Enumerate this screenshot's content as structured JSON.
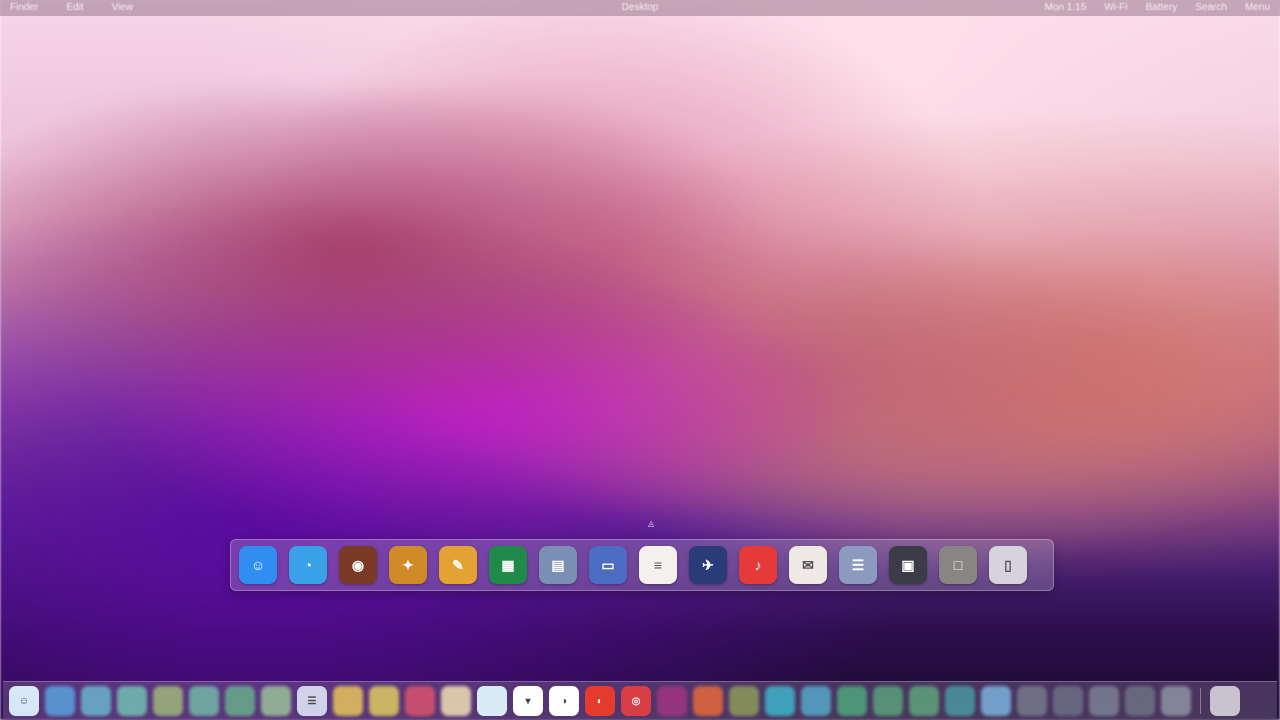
{
  "menubar": {
    "left_items": [
      "Finder",
      "Edit",
      "View"
    ],
    "center_text": "Desktop",
    "right_items": [
      "Mon 1:15",
      "Wi-Fi",
      "Battery",
      "Search",
      "Menu"
    ]
  },
  "switcher": {
    "apps": [
      {
        "name": "finder-icon",
        "glyph": "☺",
        "color": "#2f8ef0"
      },
      {
        "name": "browser-icon",
        "glyph": "◔",
        "color": "#3aa0e8"
      },
      {
        "name": "photo-app-icon",
        "glyph": "◉",
        "color": "#7a3a25"
      },
      {
        "name": "game-icon",
        "glyph": "✦",
        "color": "#d08a28"
      },
      {
        "name": "editor-icon",
        "glyph": "✎",
        "color": "#e4a235"
      },
      {
        "name": "spreadsheet-icon",
        "glyph": "▦",
        "color": "#1f8a4a"
      },
      {
        "name": "document-grid-icon",
        "glyph": "▤",
        "color": "#7a8fb4"
      },
      {
        "name": "blue-folder-icon",
        "glyph": "▭",
        "color": "#4d6cc4"
      },
      {
        "name": "text-document-icon",
        "glyph": "≡",
        "color": "#f3f0ee"
      },
      {
        "name": "launcher-icon",
        "glyph": "✈",
        "color": "#2a3b7a"
      },
      {
        "name": "media-app-icon",
        "glyph": "♪",
        "color": "#e43a3a"
      },
      {
        "name": "notes-icon",
        "glyph": "✉",
        "color": "#eeeae3"
      },
      {
        "name": "settings-panel-icon",
        "glyph": "☰",
        "color": "#8c9ac0"
      },
      {
        "name": "monitor-icon",
        "glyph": "▣",
        "color": "#3c3c48"
      },
      {
        "name": "window-icon",
        "glyph": "□",
        "color": "#8a8585"
      },
      {
        "name": "trash-icon",
        "glyph": "▯",
        "color": "#d8d2dc"
      }
    ]
  },
  "dock": {
    "apps": [
      {
        "name": "finder-dock-icon",
        "glyph": "☺",
        "color": "#d7e7f7",
        "blur": false
      },
      {
        "name": "dock-app-1-icon",
        "glyph": "",
        "color": "#5aa3de",
        "blur": true
      },
      {
        "name": "dock-app-2-icon",
        "glyph": "",
        "color": "#6bb6cd",
        "blur": true
      },
      {
        "name": "dock-app-3-icon",
        "glyph": "",
        "color": "#74c1b4",
        "blur": true
      },
      {
        "name": "dock-app-4-icon",
        "glyph": "",
        "color": "#9fb87c",
        "blur": true
      },
      {
        "name": "dock-app-5-icon",
        "glyph": "",
        "color": "#73b9a7",
        "blur": true
      },
      {
        "name": "dock-app-6-icon",
        "glyph": "",
        "color": "#68b08c",
        "blur": true
      },
      {
        "name": "dock-app-7-icon",
        "glyph": "",
        "color": "#9bc29a",
        "blur": true
      },
      {
        "name": "dock-app-8-icon",
        "glyph": "☰",
        "color": "#cfd2e8",
        "blur": false
      },
      {
        "name": "dock-app-9-icon",
        "glyph": "",
        "color": "#e7c65a",
        "blur": true
      },
      {
        "name": "dock-app-10-icon",
        "glyph": "",
        "color": "#e0cc60",
        "blur": true
      },
      {
        "name": "dock-app-11-icon",
        "glyph": "",
        "color": "#d9546d",
        "blur": true
      },
      {
        "name": "dock-app-12-icon",
        "glyph": "",
        "color": "#f2e0b5",
        "blur": true
      },
      {
        "name": "dock-app-13-icon",
        "glyph": "",
        "color": "#d8ecf7",
        "blur": false
      },
      {
        "name": "dock-app-14-icon",
        "glyph": "▾",
        "color": "#ffffff",
        "blur": false
      },
      {
        "name": "dock-app-15-icon",
        "glyph": "◑",
        "color": "#ffffff",
        "blur": false
      },
      {
        "name": "dock-app-16-icon",
        "glyph": "◐",
        "color": "#e53b2f",
        "blur": false
      },
      {
        "name": "dock-app-17-icon",
        "glyph": "◎",
        "color": "#d83c44",
        "blur": false
      },
      {
        "name": "dock-app-18-icon",
        "glyph": "",
        "color": "#a13583",
        "blur": true
      },
      {
        "name": "dock-app-19-icon",
        "glyph": "",
        "color": "#e66a3c",
        "blur": true
      },
      {
        "name": "dock-app-20-icon",
        "glyph": "",
        "color": "#8d9b5b",
        "blur": true
      },
      {
        "name": "dock-app-21-icon",
        "glyph": "",
        "color": "#3fb4c9",
        "blur": true
      },
      {
        "name": "dock-app-22-icon",
        "glyph": "",
        "color": "#56a9c9",
        "blur": true
      },
      {
        "name": "dock-app-23-icon",
        "glyph": "",
        "color": "#4fa77e",
        "blur": true
      },
      {
        "name": "dock-app-24-icon",
        "glyph": "",
        "color": "#5aa27c",
        "blur": true
      },
      {
        "name": "dock-app-25-icon",
        "glyph": "",
        "color": "#5fa57b",
        "blur": true
      },
      {
        "name": "dock-app-26-icon",
        "glyph": "",
        "color": "#4a9aa2",
        "blur": true
      },
      {
        "name": "dock-app-27-icon",
        "glyph": "",
        "color": "#7ab3dd",
        "blur": true
      },
      {
        "name": "dock-app-28-icon",
        "glyph": "",
        "color": "#777a8d",
        "blur": true
      },
      {
        "name": "dock-app-29-icon",
        "glyph": "",
        "color": "#6c7087",
        "blur": true
      },
      {
        "name": "dock-app-30-icon",
        "glyph": "",
        "color": "#7c8296",
        "blur": true
      },
      {
        "name": "dock-app-31-icon",
        "glyph": "",
        "color": "#6f7384",
        "blur": true
      },
      {
        "name": "dock-app-32-icon",
        "glyph": "",
        "color": "#8f93a5",
        "blur": true
      },
      {
        "name": "dock-trash-icon",
        "glyph": "",
        "color": "#c9c3cf",
        "blur": false
      }
    ]
  },
  "cursor": {
    "glyph": "◬"
  }
}
